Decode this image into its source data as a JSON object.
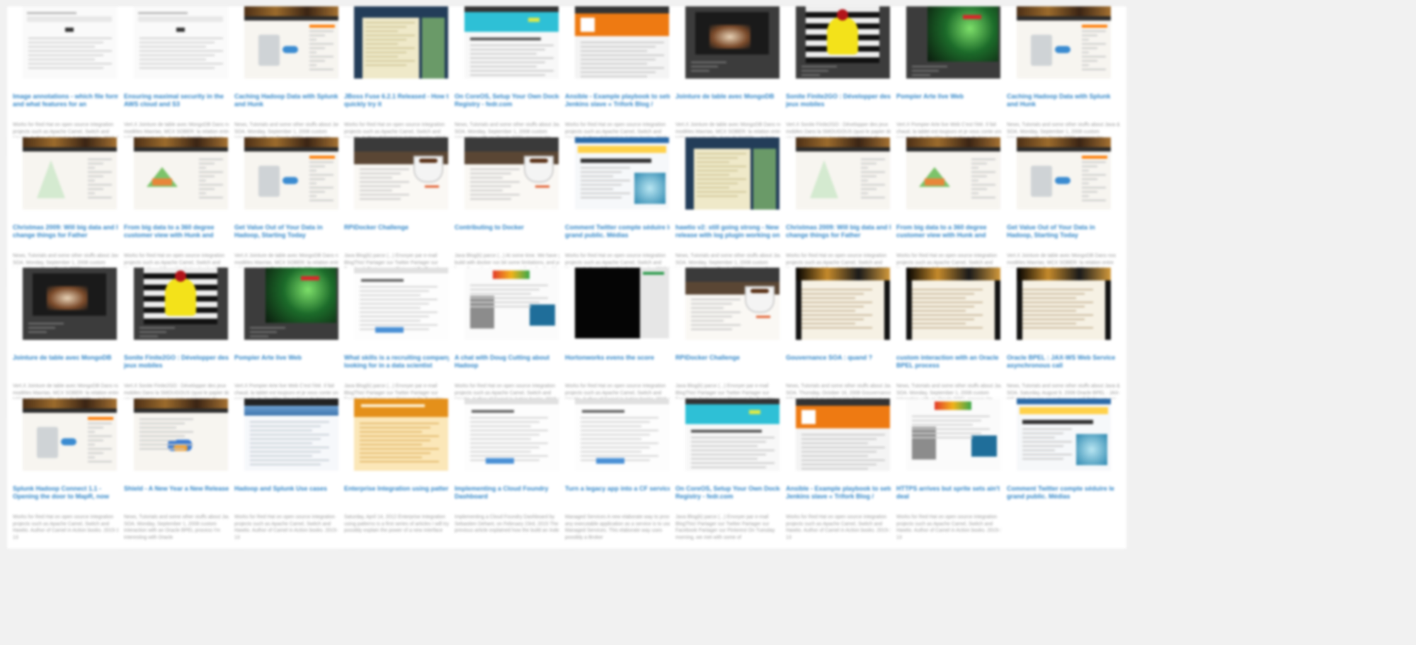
{
  "cards": [
    {
      "title": "Image annotations - which file format and what features for an",
      "excerpt": "Works for Red Hat on open source integration projects such as Apache Camel, Switch and Hawtio. Author of Camel in Action books. 2015-10-13",
      "thumb": "doc"
    },
    {
      "title": "Ensuring maximal security in the AWS cloud and S3",
      "excerpt": "Vert.X Jointure de table avec MongoDB Dans nos modèles Mavrias. MCX SOBER: la relation entre tables est naturelle. Avec de NoSQL... je hais",
      "thumb": "doc"
    },
    {
      "title": "Caching Hadoop Data with Splunk and Hunk",
      "excerpt": "News, Tutorials and some other stuffs about Java & SOA. Monday, September 1, 2008 custom interaction with an Oracle BPEL process I'm interesting with Oracle",
      "thumb": "wood"
    },
    {
      "title": "JBoss Fuse 6.2.1 Released - How to quickly try it",
      "excerpt": "Works for Red Hat on open source integration projects such as Apache Camel, Switch and Hawtio. Author of Camel in Action books. 2015-10-13",
      "thumb": "navy"
    },
    {
      "title": "On CoreOS, Setup Your Own Docker Registry - fedr.com",
      "excerpt": "News, Tutorials and some other stuffs about Java & SOA. Monday, September 1, 2008 custom interaction with an Oracle BPEL process I'm interesting with Oracle",
      "thumb": "cyan"
    },
    {
      "title": "Ansible - Example playbook to setup Jenkins slave « Trifork Blog /",
      "excerpt": "Works for Red Hat on open source integration projects such as Apache Camel, Switch and Hawtio. Author of Camel in Action books. 2015-10-13",
      "thumb": "orange"
    },
    {
      "title": "Jointure de table avec MongoDB",
      "excerpt": "Vert.X Jointure de table avec MongoDB Dans nos modèles Mavrias. MCX SOBER: la relation entre tables est naturelle. Avec de NoSQL... je hais",
      "thumb": "dark-coffee"
    },
    {
      "title": "Sonite Finite2GO : Développer des jeux mobiles",
      "excerpt": "Vert.X Sonite Finite2GO : Développer des jeux mobiles Dans la SMOUGOUS (quoi le papier de vous présenter nos howtoto expérience de",
      "thumb": "dark-yellow"
    },
    {
      "title": "Pompier Arte live Web",
      "excerpt": "Vert.X Pompier Arte live Web C'est l'été. Il fait chaud, la tablet est toujours et je vous conte une ponctuels de Peutête. Ce qu'il y a de bien avec the Nebuchec. C'est",
      "thumb": "dark-green"
    },
    {
      "title": "Caching Hadoop Data with Splunk and Hunk",
      "excerpt": "News, Tutorials and some other stuffs about Java & SOA. Monday, September 1, 2008 custom interaction with an Oracle BPEL process I'm interesting with Oracle",
      "thumb": "wood"
    },
    {
      "title": "Christmas 2009: Will big data and IOT change things for Father",
      "excerpt": "News, Tutorials and some other stuffs about Java & SOA. Monday, September 1, 2008 custom interaction with an Oracle BPEL process I'm interesting with Oracle",
      "thumb": "xmas"
    },
    {
      "title": "From big data to a 360 degree customer view with Hunk and",
      "excerpt": "Works for Red Hat on open source integration projects such as Apache Camel, Switch and Hawtio. Author of Camel in Action books. 2015-10-13",
      "thumb": "wood-tri"
    },
    {
      "title": "Get Value Out of Your Data in Hadoop, Starting Today",
      "excerpt": "Vert.X Jointure de table avec MongoDB Dans nos modèles Mavrias. MCX SOBER: la relation entre tables est naturelle. Avec de NoSQL... je hais",
      "thumb": "wood"
    },
    {
      "title": "RPiDocker Challenge",
      "excerpt": "Java Blog(k) parce (...) Envoyer par e-mail BlogThis! Partager sur Twitter Partager sur Facebook Partager sur Pinterest On Tuesday morning, we met with some of",
      "thumb": "coffee"
    },
    {
      "title": "Contributing to Docker",
      "excerpt": "Java Blog(k) parce (...) At some time. We have you build with docker run bit some limitations, and you have the option to give up contribute for this blog post Of",
      "thumb": "coffee"
    },
    {
      "title": "Comment Twitter compte séduire le grand public. Médias",
      "excerpt": "Works for Red Hat on open source integration projects such as Apache Camel, Switch and Hawtio. Author of Camel in Action books. 2015-10-13",
      "thumb": "portal"
    },
    {
      "title": "hawtio v2: still going strong - New release with log plugin working on",
      "excerpt": "News, Tutorials and some other stuffs about Java & SOA. Monday, September 1, 2008 custom interaction with an Oracle BPEL process I'm interesting with Oracle",
      "thumb": "navy"
    },
    {
      "title": "Christmas 2009: Will big data and IOT change things for Father",
      "excerpt": "Works for Red Hat on open source integration projects such as Apache Camel, Switch and Hawtio. Author of Camel in Action books. 2015-10-13",
      "thumb": "xmas"
    },
    {
      "title": "From big data to a 360 degree customer view with Hunk and",
      "excerpt": "Works for Red Hat on open source integration projects such as Apache Camel, Switch and Hawtio. Author of Camel in Action books. 2015-10-13",
      "thumb": "wood-tri"
    },
    {
      "title": "Get Value Out of Your Data in Hadoop, Starting Today",
      "excerpt": "Vert.X Jointure de table avec MongoDB Dans nos modèles Mavrias. MCX SOBER: la relation entre tables est naturelle. Avec de NoSQL... je hais",
      "thumb": "wood"
    },
    {
      "title": "Jointure de table avec MongoDB",
      "excerpt": "Vert.X Jointure de table avec MongoDB Dans nos modèles Mavrias. MCX SOBER: la relation entre tables est naturelle. Avec de NoSQL... je hais",
      "thumb": "dark-coffee"
    },
    {
      "title": "Sonite Finite2GO : Développer des jeux mobiles",
      "excerpt": "Vert.X Sonite Finite2GO : Développer des jeux mobiles Dans la SMOUGOUS (quoi le papier de vous présenter nos howtoto expérience de",
      "thumb": "dark-yellow"
    },
    {
      "title": "Pompier Arte live Web",
      "excerpt": "Vert.X Pompier Arte live Web C'est l'été. Il fait chaud, la tablet est toujours et je vous conte une ponctuels de Peutête. Ce qu'il y a de bien avec the Nebuchec. C'est",
      "thumb": "dark-green"
    },
    {
      "title": "What skills is a recruiting company looking for in a data scientist",
      "excerpt": "Java Blog(k) parce (...) Envoyer par e-mail BlogThis! Partager sur Twitter Partager sur Facebook Partager sur Pinterest On Tuesday morning, we met with some of",
      "thumb": "white-doc"
    },
    {
      "title": "A chat with Doug Cutting about Hadoop",
      "excerpt": "Works for Red Hat on open source integration projects such as Apache Camel, Switch and Hawtio. Author of Camel in Action books. 2015-10-13",
      "thumb": "chat"
    },
    {
      "title": "Hortonworks evens the score",
      "excerpt": "Works for Red Hat on open source integration projects such as Apache Camel, Switch and Hawtio. Author of Camel in Action books. 2015-10-13",
      "thumb": "black"
    },
    {
      "title": "RPiDocker Challenge",
      "excerpt": "Java Blog(k) parce (...) Envoyer par e-mail BlogThis! Partager sur Twitter Partager sur Facebook Partager sur Pinterest On Tuesday morning, we met with some of",
      "thumb": "coffee"
    },
    {
      "title": "Gouvernance SOA : quand ?",
      "excerpt": "News, Tutorials and some other stuffs about Java & SOA. Thursday, October 16, 2008 Gouvernance SOA : quand ? en parlant très fréquemment sur la gouvernance",
      "thumb": "wood-dark"
    },
    {
      "title": "custom interaction with an Oracle BPEL process",
      "excerpt": "News, Tutorials and some other stuffs about Java & SOA. Monday, September 1, 2008 custom interaction with an Oracle BPEL process I'm interesting with Oracle",
      "thumb": "wood-dark"
    },
    {
      "title": "Oracle BPEL : JAX-WS Web Service asynchronous call",
      "excerpt": "News, Tutorials and some other stuffs about Java & SOA. Saturday, August 9, 2008 Oracle BPEL : JAX-WS Web Service asynchronous call Today we are",
      "thumb": "wood-dark"
    },
    {
      "title": "Splunk Hadoop Connect 1.1 - Opening the door to MapR, now",
      "excerpt": "Works for Red Hat on open source integration projects such as Apache Camel, Switch and Hawtio. Author of Camel in Action books. 2015-10-13",
      "thumb": "wood"
    },
    {
      "title": "Shield - A New Year a New Release",
      "excerpt": "News, Tutorials and some other stuffs about Java & SOA. Monday, September 1, 2008 custom interaction with an Oracle BPEL process I'm interesting with Oracle",
      "thumb": "wood-logo"
    },
    {
      "title": "Hadoop and Splunk Use cases",
      "excerpt": "Works for Red Hat on open source integration projects such as Apache Camel, Switch and Hawtio. Author of Camel in Action books. 2015-10-13",
      "thumb": "blue-doc"
    },
    {
      "title": "Enterprise Integration using patterns",
      "excerpt": "Saturday, April 14, 2012 Enterprise Integration using patterns is a first series of articles I will try to possibly explain the power of a new interface",
      "thumb": "amber"
    },
    {
      "title": "Implementing a Cloud Foundry Dashboard",
      "excerpt": "Implementing a Cloud Foundry Dashboard by Sebastien Dehant, on February 23rd, 2015 The previous article explained how the build an Indexer",
      "thumb": "white-doc"
    },
    {
      "title": "Turn a legacy app into a CF service",
      "excerpt": "Managed Services A new elaborate way to provide any executable application as a service is to use Managed Services. This elaborate way uses possibly a Broker",
      "thumb": "white-doc"
    },
    {
      "title": "On CoreOS, Setup Your Own Docker Registry - fedr.com",
      "excerpt": "Java Blog(k) parce (...) Envoyer par e-mail BlogThis! Partager sur Twitter Partager sur Facebook Partager sur Pinterest On Tuesday morning, we met with some of",
      "thumb": "cyan"
    },
    {
      "title": "Ansible - Example playbook to setup Jenkins slave « Trifork Blog /",
      "excerpt": "Works for Red Hat on open source integration projects such as Apache Camel, Switch and Hawtio. Author of Camel in Action books. 2015-10-13",
      "thumb": "orange"
    },
    {
      "title": "HTTPS arrives but sprite sets ain't no deal",
      "excerpt": "Works for Red Hat on open source integration projects such as Apache Camel, Switch and Hawtio. Author of Camel in Action books. 2015-10-13",
      "thumb": "chat"
    },
    {
      "title": "Comment Twitter compte séduire le grand public. Médias",
      "excerpt": "",
      "thumb": "portal"
    }
  ]
}
